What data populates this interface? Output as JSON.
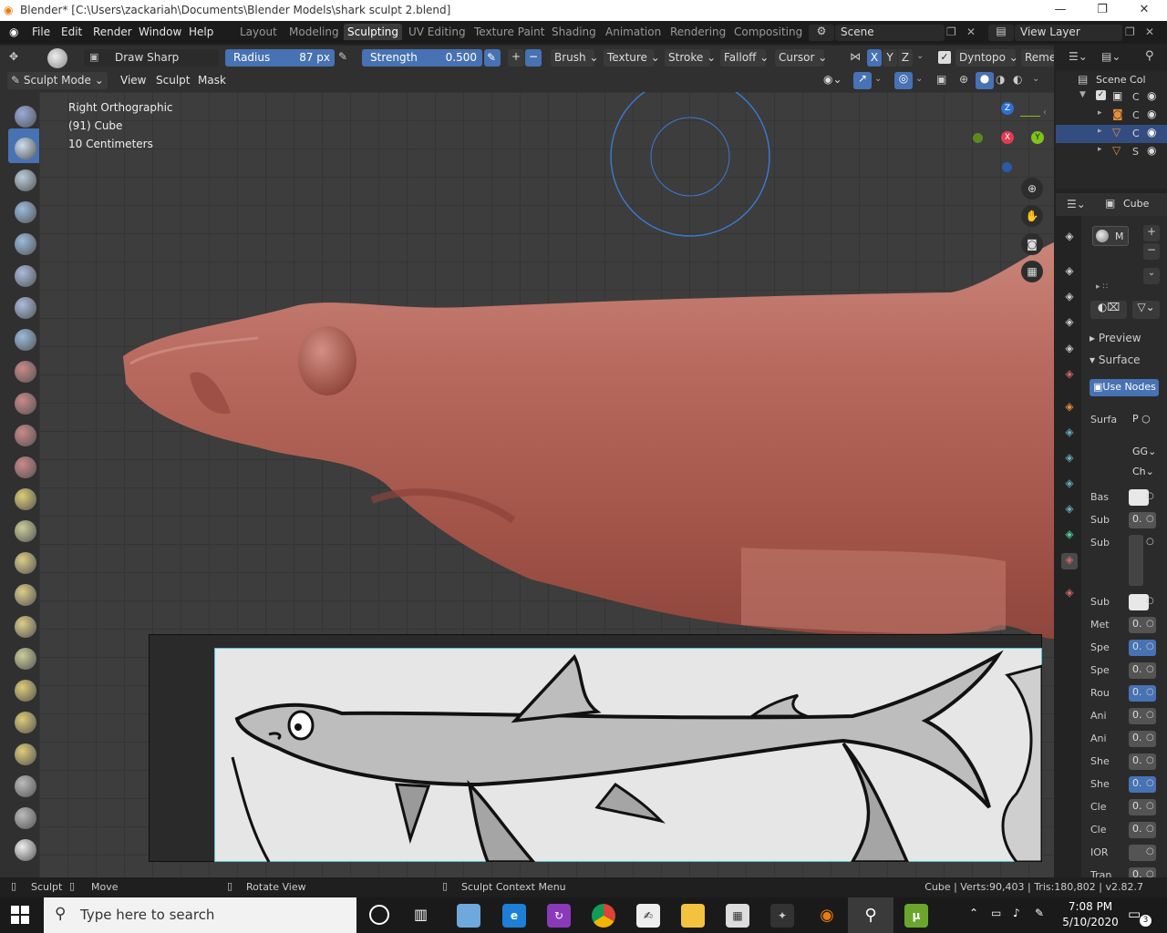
{
  "window": {
    "title": "Blender* [C:\\Users\\zackariah\\Documents\\Blender Models\\shark sculpt 2.blend]",
    "minimize": "—",
    "maximize": "❐",
    "close": "✕"
  },
  "menu": {
    "items": [
      "File",
      "Edit",
      "Render",
      "Window",
      "Help"
    ]
  },
  "workspaces": {
    "tabs": [
      "Layout",
      "Modeling",
      "Sculpting",
      "UV Editing",
      "Texture Paint",
      "Shading",
      "Animation",
      "Rendering",
      "Compositing"
    ],
    "active": "Sculpting"
  },
  "scene": {
    "name": "Scene",
    "view_layer": "View Layer"
  },
  "tool_header": {
    "brush_name": "Draw Sharp",
    "radius_label": "Radius",
    "radius_value": "87 px",
    "strength_label": "Strength",
    "strength_value": "0.500",
    "plus": "+",
    "minus": "−",
    "dropdowns": [
      "Brush",
      "Texture",
      "Stroke",
      "Falloff",
      "Cursor"
    ],
    "axes": [
      "X",
      "Y",
      "Z"
    ],
    "dyntopo": "Dyntopo",
    "remesh": "Reme"
  },
  "mode_header": {
    "mode": "Sculpt Mode",
    "menus": [
      "View",
      "Sculpt",
      "Mask"
    ]
  },
  "viewport": {
    "view_name": "Right Orthographic",
    "object": "(91) Cube",
    "scale": "10 Centimeters"
  },
  "gizmo": {
    "z": "Z",
    "x": "X",
    "y": "Y"
  },
  "outliner": {
    "title": "Scene Col",
    "rows": [
      "C",
      "C",
      "C",
      "S"
    ]
  },
  "properties": {
    "object": "Cube",
    "material_slot": "M",
    "preview": "Preview",
    "surface": "Surface",
    "use_nodes": "Use Nodes",
    "surface_label": "Surfa",
    "surface_value": "P",
    "gg": "GG",
    "ch": "Ch",
    "rows": [
      {
        "label": "Bas",
        "value": ""
      },
      {
        "label": "Sub",
        "value": "0."
      },
      {
        "label": "Sub",
        "value": ""
      },
      {
        "label": "Sub",
        "value": ""
      },
      {
        "label": "Met",
        "value": "0."
      },
      {
        "label": "Spe",
        "value": "0."
      },
      {
        "label": "Spe",
        "value": "0."
      },
      {
        "label": "Rou",
        "value": "0."
      },
      {
        "label": "Ani",
        "value": "0."
      },
      {
        "label": "Ani",
        "value": "0."
      },
      {
        "label": "She",
        "value": "0."
      },
      {
        "label": "She",
        "value": "0."
      },
      {
        "label": "Cle",
        "value": "0."
      },
      {
        "label": "Cle",
        "value": "0."
      },
      {
        "label": "IOR",
        "value": ""
      },
      {
        "label": "Tran",
        "value": "0."
      }
    ]
  },
  "status": {
    "sculpt": "Sculpt",
    "move": "Move",
    "rotate": "Rotate View",
    "context": "Sculpt Context Menu",
    "stats": "Cube | Verts:90,403 | Tris:180,802 | v2.82.7"
  },
  "taskbar": {
    "search": "Type here to search",
    "time": "7:08 PM",
    "date": "5/10/2020",
    "notifications": "3"
  },
  "colors": {
    "accent": "#4772b3",
    "sculpt": "#b86a5e",
    "brush_circle": "#3a7bd5"
  }
}
